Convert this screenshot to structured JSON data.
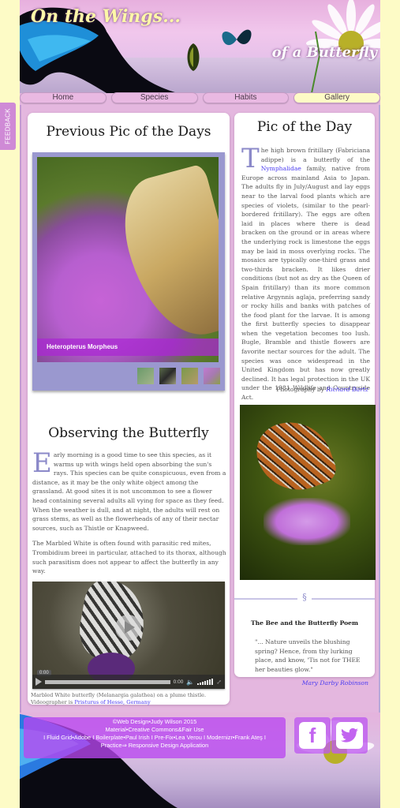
{
  "header": {
    "title": "On the Wings...",
    "subtitle": "of a Butterfly"
  },
  "nav": {
    "tabs": [
      {
        "label": "Home",
        "active": false
      },
      {
        "label": "Species",
        "active": false
      },
      {
        "label": "Habits",
        "active": false
      },
      {
        "label": "Gallery",
        "active": true
      }
    ]
  },
  "feedback": {
    "label": "FEEDBACK"
  },
  "previous": {
    "title": "Previous Pic of the Days",
    "slide_caption": "Heteropterus Morpheus",
    "thumbnails": 4
  },
  "observing": {
    "title": "Observing the Butterfly",
    "drop_cap": "E",
    "para1": "arly morning is a good time to see this species, as it warms up with wings held open absorbing the sun's rays. This species can be quite conspicuous, even from a distance, as it may be the only white object among the grassland. At good sites it is not uncommon to see a flower head containing several adults all vying for space as they feed. When the weather is dull, and at night, the adults will rest on grass stems, as well as the flowerheads of any of their nectar sources, such as Thistle or Knapweed.",
    "para2": "The Marbled White is often found with parasitic red mites, Trombidium breei in particular, attached to its thorax, although such parasitism does not appear to affect the butterfly in any way."
  },
  "video": {
    "time_tooltip": "0:00",
    "current_time": "0:00",
    "progress_percent": 0,
    "caption_text": "Marbled White butterfly (Melanargia galathea) on a plume thistle. Videographer is ",
    "caption_link": "Pristurus of Hesse, Germany"
  },
  "pic_of_day": {
    "title": "Pic of the Day",
    "drop_cap": "T",
    "text_before_link": "he high brown fritillary (Fabriciana adippe) is a butterfly of the ",
    "link": "Nymphalidae",
    "text_after_link": " family, native from Europe across mainland Asia to Japan. The adults fly in July/August and lay eggs near to the larval food plants which are species of violets, (similar to the pearl-bordered fritillary). The eggs are often laid in places where there is dead bracken on the ground or in areas where the underlying rock is limestone the eggs may be laid in moss overlying rocks. The mosaics are typically one-third grass and two-thirds bracken. It likes drier conditions (but not as dry as the Queen of Spain fritillary) than its more common relative Argynnis aglaja, preferring sandy or rocky hills and banks with patches of the food plant for the larvae. It is among the first butterfly species to disappear when the vegetation becomes too lush. Bugle, Bramble and thistle flowers are favorite nectar sources for the adult. The species was once widespread in the United Kingdom but has now greatly declined. It has legal protection in the UK under the 1981 Wildlife and Countryside Act.",
    "credit_label": "Photography by ",
    "credit_link": "Richard Bartz"
  },
  "poem": {
    "section_mark": "§",
    "title": "The Bee and the Butterfly Poem",
    "text": "\"... Nature unveils the blushing spring? Hence, from thy lurking place, and know, 'Tis not for THEE her beauties glow.\"",
    "author": "Mary Darby Robinson"
  },
  "footer": {
    "lines": [
      "©Web Design•Judy Wilson 2015",
      "Material•Creative Commons&Fair Use",
      "I Fluid Grid•Adobe I  Boilerplate•Paul Irish I Pre-Fix•Lea Verou I Modernizr•Frank Ateş I",
      "Practice⇒ Responsive Design Application"
    ],
    "social": [
      {
        "name": "facebook",
        "glyph": "f"
      },
      {
        "name": "twitter",
        "glyph": "🐦"
      }
    ]
  },
  "colors": {
    "page_bg": "#fdfbc6",
    "frame": "#e4b7df",
    "accent_purple": "#b946f0",
    "drop_cap": "#8b89c9",
    "link": "#4b3cf0"
  }
}
